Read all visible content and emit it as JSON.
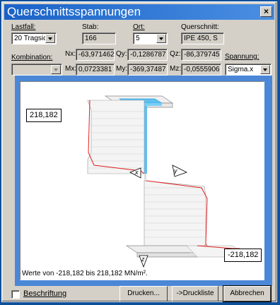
{
  "window": {
    "title": "Querschnittsspannungen",
    "close_glyph": "×"
  },
  "labels": {
    "lastfall": "Lastfall:",
    "stab": "Stab:",
    "ort": "Ort:",
    "querschnitt": "Querschnitt:",
    "kombination": "Kombination:",
    "spannung": "Spannung:"
  },
  "fields": {
    "lastfall": "20 Tragsic",
    "stab": "166",
    "ort": "5",
    "querschnitt": "IPE 450, S",
    "kombination": "",
    "spannung": "Sigma.x"
  },
  "forces": {
    "nx_label": "Nx:",
    "nx": "-63,971462",
    "qy_label": "Qy:",
    "qy": "-0,1286787",
    "qz_label": "Qz:",
    "qz": "-86,379745",
    "mx_label": "Mx:",
    "mx": "0,0723381",
    "my_label": "My:",
    "my": "-369,37487",
    "mz_label": "Mz:",
    "mz": "-0,0555906"
  },
  "canvas": {
    "max_label": "218,182",
    "min_label": "-218,182",
    "axis_y": "y",
    "axis_x": "x",
    "axis_z": "z",
    "range_text": "Werte von -218,182 bis 218,182 MN/m²."
  },
  "bottom": {
    "beschriftung": "Beschriftung",
    "drucken": "Drucken...",
    "druckliste": "->Druckliste",
    "abbrechen": "Abbrechen"
  },
  "colors": {
    "title_bg": "#1a62c7",
    "desktop": "#0f4f9b",
    "highlight": "#5fc0f0",
    "stress_line": "#e02020"
  }
}
